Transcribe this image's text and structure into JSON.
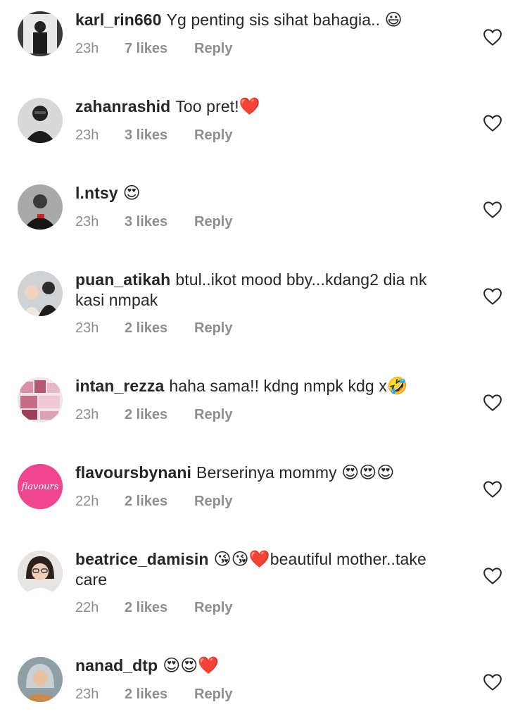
{
  "comments": [
    {
      "username": "karl_rin660",
      "text": "Yg penting sis sihat bahagia.. ",
      "emoji": "😃",
      "time": "23h",
      "likes": "7 likes",
      "reply": "Reply"
    },
    {
      "username": "zahanrashid",
      "text": "Too pret!",
      "emoji": "❤️",
      "time": "23h",
      "likes": "3 likes",
      "reply": "Reply"
    },
    {
      "username": "l.ntsy",
      "text": "",
      "emoji": "😍",
      "time": "23h",
      "likes": "3 likes",
      "reply": "Reply"
    },
    {
      "username": "puan_atikah",
      "text": "btul..ikot mood bby...kdang2 dia nk kasi nmpak",
      "emoji": "",
      "time": "23h",
      "likes": "2 likes",
      "reply": "Reply"
    },
    {
      "username": "intan_rezza",
      "text": "haha sama!! kdng nmpk kdg x",
      "emoji": "🤣",
      "time": "23h",
      "likes": "2 likes",
      "reply": "Reply"
    },
    {
      "username": "flavoursbynani",
      "text": "Berserinya mommy ",
      "emoji": "😍😍😍",
      "time": "22h",
      "likes": "2 likes",
      "reply": "Reply"
    },
    {
      "username": "beatrice_damisin",
      "text": "beautiful mother..take care",
      "emoji": "😘😘❤️",
      "time": "22h",
      "likes": "2 likes",
      "reply": "Reply"
    },
    {
      "username": "nanad_dtp",
      "text": "",
      "emoji": "😍😍❤️",
      "time": "23h",
      "likes": "2 likes",
      "reply": "Reply"
    }
  ],
  "avatar_flavours_text": "flavours",
  "colors": {
    "meta": "#8e8e8e",
    "text": "#262626",
    "brand_pink": "#f0468f"
  }
}
